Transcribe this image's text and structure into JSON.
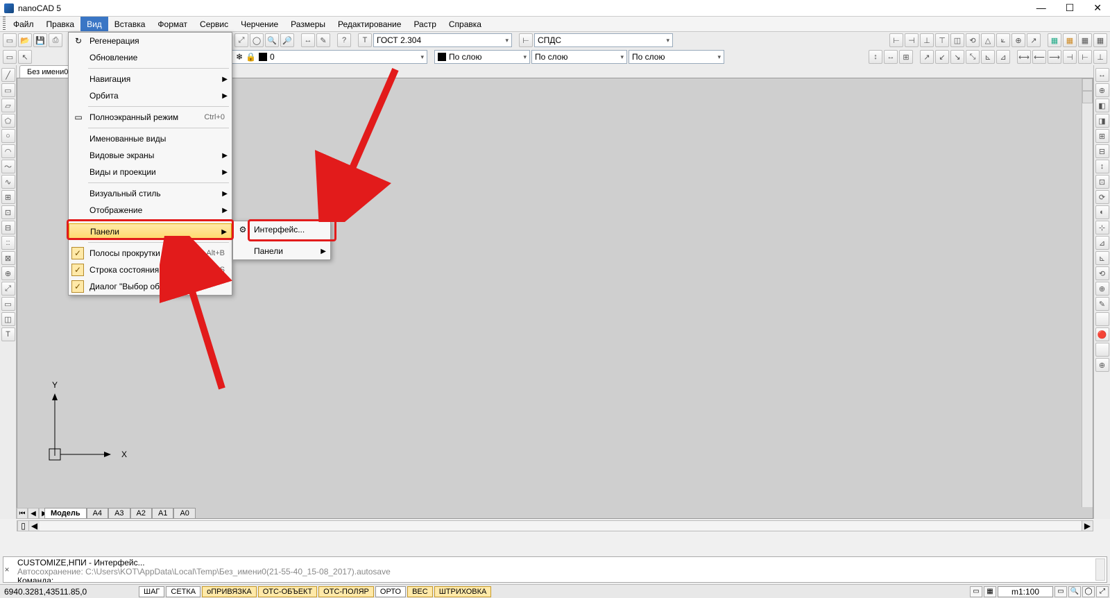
{
  "title": "nanoCAD 5",
  "menubar": [
    "Файл",
    "Правка",
    "Вид",
    "Вставка",
    "Формат",
    "Сервис",
    "Черчение",
    "Размеры",
    "Редактирование",
    "Растр",
    "Справка"
  ],
  "menubar_active_index": 2,
  "fields": {
    "font": "ГОСТ 2.304",
    "style2": "СПДС",
    "layer": "0",
    "color": "По слою",
    "lw": "По слою",
    "lt": "По слою"
  },
  "doc_tab": "Без имени0",
  "view_menu": [
    {
      "t": "item",
      "label": "Регенерация",
      "icon": "↻"
    },
    {
      "t": "item",
      "label": "Обновление"
    },
    {
      "t": "sep"
    },
    {
      "t": "item",
      "label": "Навигация",
      "arrow": true
    },
    {
      "t": "item",
      "label": "Орбита",
      "arrow": true
    },
    {
      "t": "sep"
    },
    {
      "t": "item",
      "label": "Полноэкранный режим",
      "icon": "▭",
      "shortcut": "Ctrl+0"
    },
    {
      "t": "sep"
    },
    {
      "t": "item",
      "label": "Именованные виды"
    },
    {
      "t": "item",
      "label": "Видовые экраны",
      "arrow": true
    },
    {
      "t": "item",
      "label": "Виды и проекции",
      "arrow": true
    },
    {
      "t": "sep"
    },
    {
      "t": "item",
      "label": "Визуальный стиль",
      "arrow": true
    },
    {
      "t": "item",
      "label": "Отображение",
      "arrow": true
    },
    {
      "t": "sep"
    },
    {
      "t": "item",
      "label": "Панели",
      "arrow": true,
      "hi": true
    },
    {
      "t": "sep"
    },
    {
      "t": "item",
      "label": "Полосы прокрутки",
      "check": true,
      "shortcut": "Alt+B"
    },
    {
      "t": "item",
      "label": "Строка состояния",
      "check": true,
      "shortcut": "Alt+S"
    },
    {
      "t": "item",
      "label": "Диалог \"Выбор объектов\"",
      "check": true
    }
  ],
  "submenu": [
    {
      "label": "Интерфейс...",
      "icon": "⚙",
      "hi": false
    },
    {
      "sep": true
    },
    {
      "label": "Панели",
      "arrow": true
    }
  ],
  "layout_tabs": [
    "Модель",
    "А4",
    "А3",
    "А2",
    "А1",
    "А0"
  ],
  "layout_active": 0,
  "ucs": {
    "x": "X",
    "y": "Y"
  },
  "cmd": {
    "line1": "CUSTOMIZE,НПИ - Интерфейс...",
    "line2": "Автосохранение: C:\\Users\\KOT\\AppData\\Local\\Temp\\Без_имени0(21-55-40_15-08_2017).autosave",
    "line3": "Команда:"
  },
  "status": {
    "coords": "6940.3281,43511.85,0",
    "toggles": [
      {
        "label": "ШАГ",
        "on": false
      },
      {
        "label": "СЕТКА",
        "on": false
      },
      {
        "label": "оПРИВЯЗКА",
        "on": true
      },
      {
        "label": "ОТС-ОБЪЕКТ",
        "on": true
      },
      {
        "label": "ОТС-ПОЛЯР",
        "on": true
      },
      {
        "label": "ОРТО",
        "on": false
      },
      {
        "label": "ВЕС",
        "on": true
      },
      {
        "label": "ШТРИХОВКА",
        "on": true
      }
    ],
    "scale": "m1:100"
  }
}
